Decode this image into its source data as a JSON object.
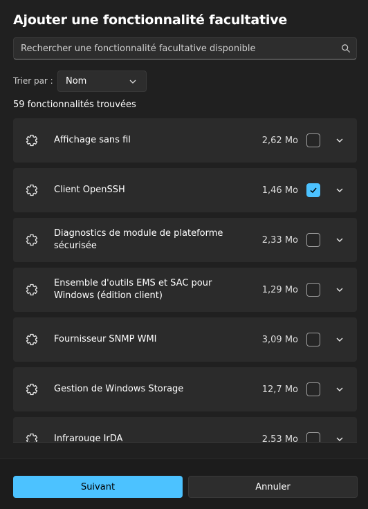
{
  "dialog": {
    "title": "Ajouter une fonctionnalité facultative"
  },
  "search": {
    "placeholder": "Rechercher une fonctionnalité facultative disponible",
    "icon": "search-icon"
  },
  "sort": {
    "label": "Trier par :",
    "selected": "Nom"
  },
  "results": {
    "count_text": "59 fonctionnalités trouvées"
  },
  "features": [
    {
      "name": "Affichage sans fil",
      "size": "2,62 Mo",
      "checked": false
    },
    {
      "name": "Client OpenSSH",
      "size": "1,46 Mo",
      "checked": true
    },
    {
      "name": "Diagnostics de module de plateforme sécurisée",
      "size": "2,33 Mo",
      "checked": false
    },
    {
      "name": "Ensemble d'outils EMS et SAC pour Windows (édition client)",
      "size": "1,29 Mo",
      "checked": false
    },
    {
      "name": "Fournisseur SNMP WMI",
      "size": "3,09 Mo",
      "checked": false
    },
    {
      "name": "Gestion de Windows Storage",
      "size": "12,7 Mo",
      "checked": false
    },
    {
      "name": "Infrarouge IrDA",
      "size": "2,53 Mo",
      "checked": false
    }
  ],
  "buttons": {
    "next": "Suivant",
    "cancel": "Annuler"
  },
  "colors": {
    "accent": "#4cc2ff",
    "background": "#202020",
    "row": "#2b2b2b"
  }
}
